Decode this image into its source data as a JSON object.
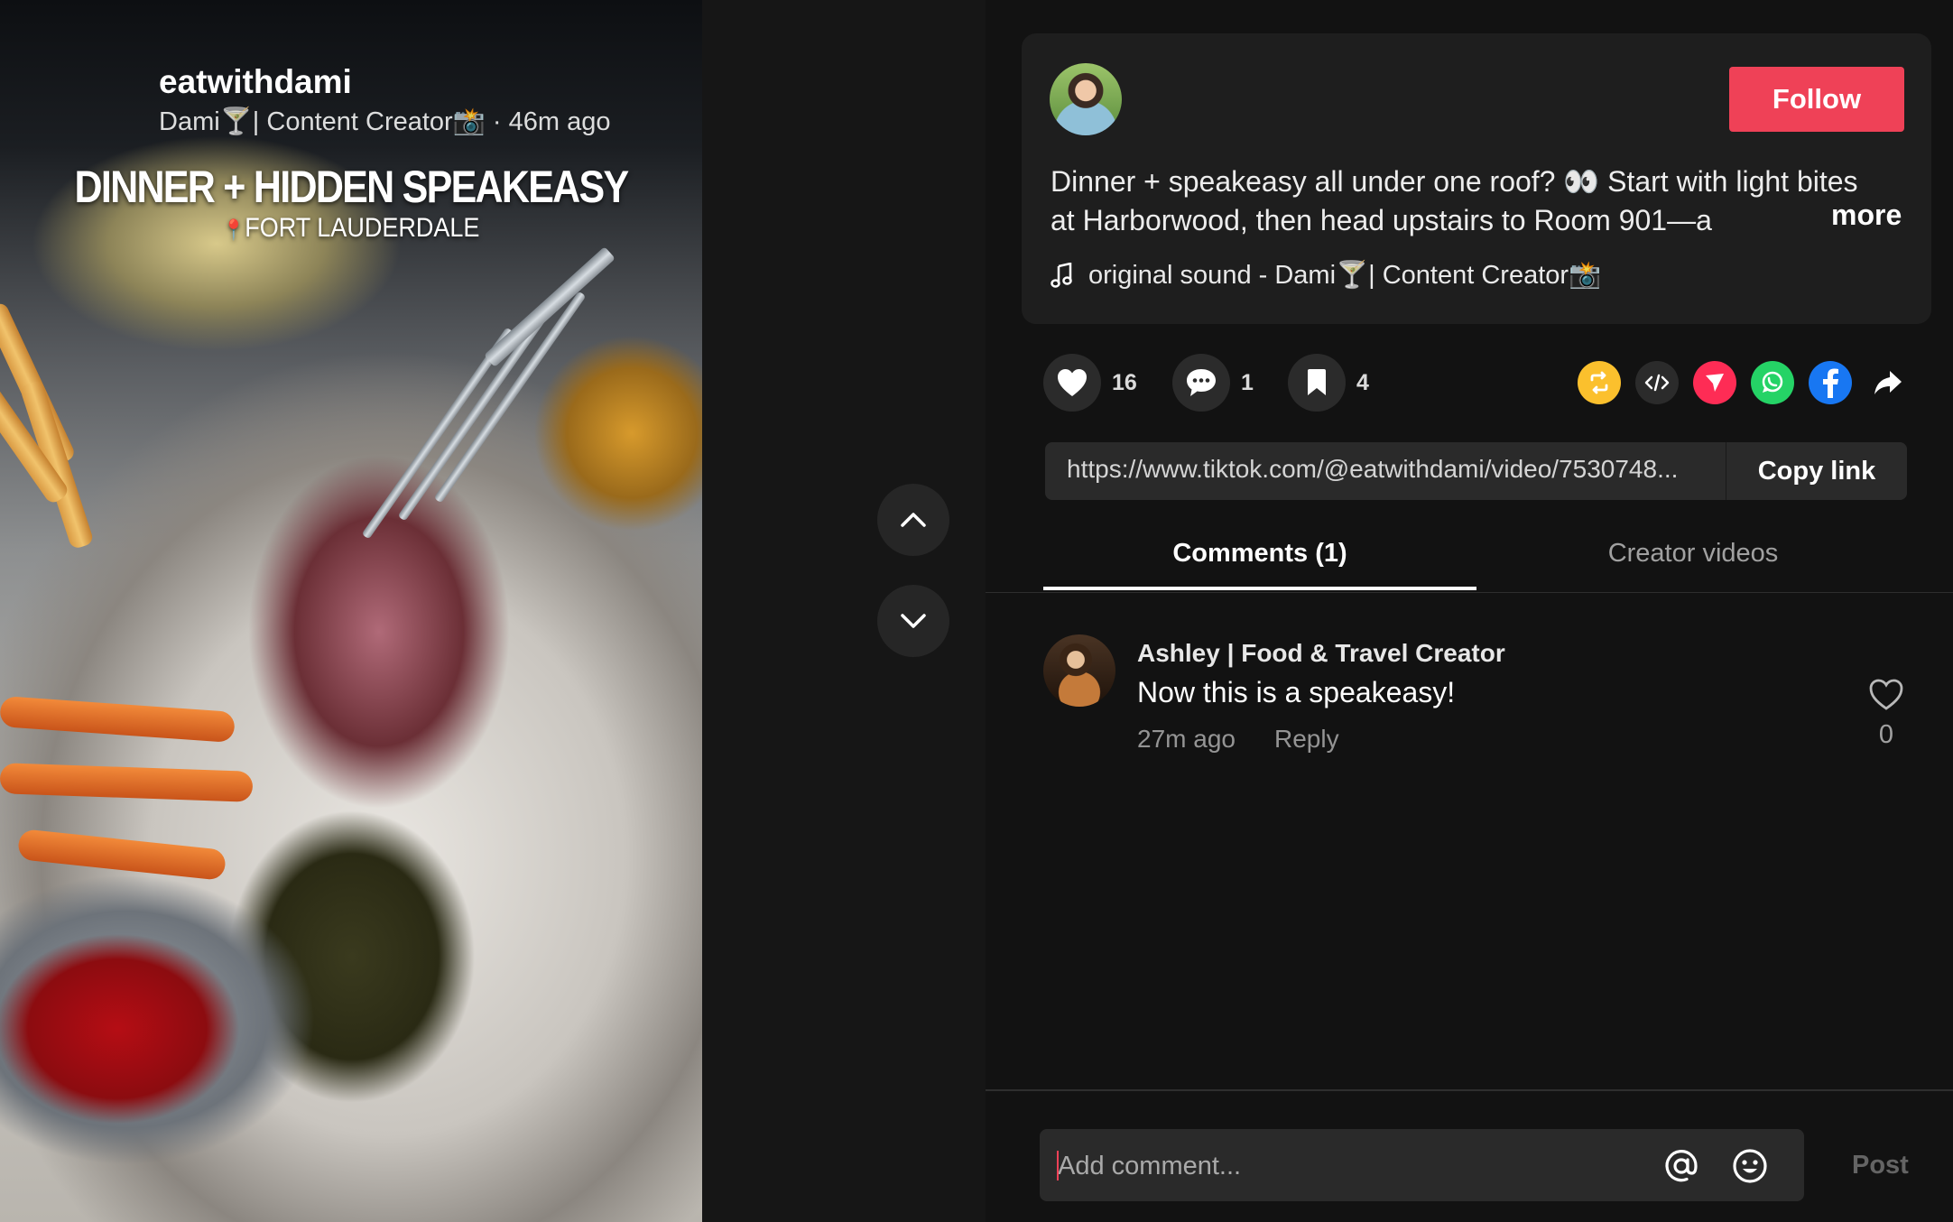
{
  "video": {
    "overlay_title": "DINNER + HIDDEN SPEAKEASY",
    "overlay_subtitle": "FORT LAUDERDALE"
  },
  "nav": {
    "up_icon": "chevron-up-icon",
    "down_icon": "chevron-down-icon"
  },
  "post": {
    "username": "eatwithdami",
    "display_name": "Dami🍸| Content Creator📸",
    "separator": "·",
    "time_ago": "46m ago",
    "follow_label": "Follow",
    "description": "Dinner + speakeasy all under one roof? 👀 Start with light bites at Harborwood, then head upstairs to Room 901—a",
    "more_label": "more",
    "music": "original sound - Dami🍸| Content Creator📸"
  },
  "actions": {
    "likes": "16",
    "comments": "1",
    "saves": "4"
  },
  "share_icons": [
    "repost-icon",
    "embed-icon",
    "send-icon",
    "whatsapp-icon",
    "facebook-icon",
    "share-arrow-icon"
  ],
  "link": {
    "url": "https://www.tiktok.com/@eatwithdami/video/7530748...",
    "copy_label": "Copy link"
  },
  "tabs": [
    {
      "label": "Comments (1)",
      "active": true
    },
    {
      "label": "Creator videos",
      "active": false
    }
  ],
  "comments": [
    {
      "author": "Ashley | Food & Travel Creator",
      "text": "Now this is a speakeasy!",
      "time": "27m ago",
      "reply_label": "Reply",
      "likes": "0"
    }
  ],
  "composer": {
    "placeholder": "Add comment...",
    "post_label": "Post"
  },
  "colors": {
    "accent": "#ef4157",
    "panel_bg": "#121212",
    "card_bg": "#1e1e1e"
  }
}
